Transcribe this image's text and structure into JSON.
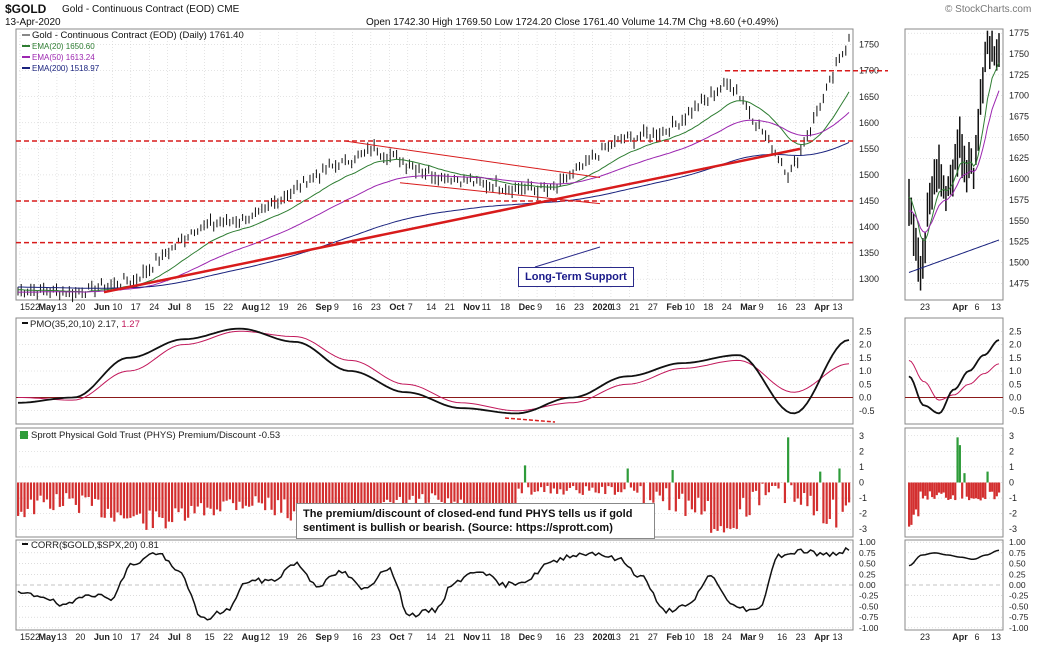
{
  "header": {
    "symbol": "$GOLD",
    "symbol_desc": "Gold - Continuous Contract (EOD) CME",
    "date": "13-Apr-2020",
    "ohlc": "Open 1742.30  High 1769.50  Low 1724.20  Close 1761.40  Volume 14.7M  Chg +8.60 (+0.49%)",
    "watermark": "© StockCharts.com"
  },
  "colors": {
    "ema20": "#2e7d32",
    "ema50": "#9c27b0",
    "ema200": "#1a237e",
    "support": "#d81b1b",
    "pmo": "#111111",
    "pmo_signal": "#c2185b",
    "positive_bar": "#2e9c3a",
    "negative_bar": "#d32f2f",
    "grid": "#c8c8c8"
  },
  "callouts": {
    "support_label": "Long-Term Support",
    "phys_note": "The premium/discount of closed-end fund PHYS tells us if gold sentiment is bullish or bearish. (Source: https://sprott.com)"
  },
  "chart_data": [
    {
      "type": "line",
      "panel": "price-daily",
      "legend": [
        "Gold - Continuous Contract (EOD) (Daily) 1761.40",
        "EMA(20) 1650.60",
        "EMA(50) 1613.24",
        "EMA(200) 1518.97"
      ],
      "y_ticks": [
        1300,
        1350,
        1400,
        1450,
        1500,
        1550,
        1600,
        1650,
        1700,
        1750
      ],
      "ylim": [
        1260,
        1780
      ],
      "x_tick_labels": [
        "1522",
        "May",
        "13",
        "20",
        "Jun",
        "10",
        "17",
        "24",
        "Jul",
        "8",
        "15",
        "22",
        "Aug",
        "12",
        "19",
        "26",
        "Sep",
        "9",
        "16",
        "23",
        "Oct",
        "7",
        "14",
        "21",
        "Nov",
        "11",
        "18",
        "Dec",
        "9",
        "16",
        "23",
        "2020",
        "13",
        "21",
        "27",
        "Feb",
        "10",
        "18",
        "24",
        "Mar",
        "9",
        "16",
        "23",
        "Apr",
        "13"
      ],
      "horizontal_levels": [
        1700,
        1565,
        1450,
        1370
      ],
      "anchor_points": [
        {
          "date": "Apr-2019",
          "close": 1280
        },
        {
          "date": "May-2019",
          "close": 1275
        },
        {
          "date": "Jun-2019",
          "close": 1300
        },
        {
          "date": "Jun-2019",
          "close": 1400
        },
        {
          "date": "Jul-2019",
          "close": 1420
        },
        {
          "date": "Aug-2019",
          "close": 1500
        },
        {
          "date": "Sep-2019",
          "close": 1550
        },
        {
          "date": "Oct-2019",
          "close": 1500
        },
        {
          "date": "Nov-2019",
          "close": 1480
        },
        {
          "date": "Dec-2019",
          "close": 1470
        },
        {
          "date": "Jan-2020",
          "close": 1560
        },
        {
          "date": "Feb-2020",
          "close": 1590
        },
        {
          "date": "Feb-2020",
          "close": 1680
        },
        {
          "date": "Mar-2020",
          "close": 1500
        },
        {
          "date": "Apr-2020",
          "close": 1761
        }
      ]
    },
    {
      "type": "line",
      "panel": "price-zoom",
      "y_ticks": [
        1475,
        1500,
        1525,
        1550,
        1575,
        1600,
        1625,
        1650,
        1675,
        1700,
        1725,
        1750,
        1775
      ],
      "ylim": [
        1455,
        1780
      ],
      "x_tick_labels": [
        "23",
        "Apr",
        "6",
        "13"
      ]
    },
    {
      "type": "line",
      "panel": "pmo",
      "legend": [
        "PMO(35,20,10) 2.17,",
        "1.27"
      ],
      "series": [
        {
          "name": "PMO",
          "values": [
            -0.2,
            0.0,
            1.5,
            2.2,
            2.6,
            2.1,
            1.0,
            0.2,
            -0.4,
            -0.6,
            0.0,
            0.8,
            1.3,
            1.6,
            -0.6,
            2.17
          ]
        },
        {
          "name": "Signal",
          "values": [
            0.0,
            -0.1,
            1.0,
            2.0,
            2.5,
            2.3,
            1.4,
            0.5,
            -0.2,
            -0.5,
            -0.2,
            0.5,
            1.1,
            1.4,
            0.2,
            1.27
          ]
        }
      ],
      "y_ticks": [
        -0.5,
        0.0,
        0.5,
        1.0,
        1.5,
        2.0,
        2.5
      ],
      "ylim": [
        -1.0,
        3.0
      ]
    },
    {
      "type": "bar",
      "panel": "phys-premium",
      "legend": "Sprott Physical Gold Trust (PHYS) Premium/Discount -0.53",
      "y_ticks": [
        -3,
        -2,
        -1,
        0,
        1,
        2,
        3
      ],
      "ylim": [
        -3.5,
        3.5
      ]
    },
    {
      "type": "line",
      "panel": "correlation",
      "legend": "CORR($GOLD,$SPX,20) 0.81",
      "y_ticks": [
        -1.0,
        -0.75,
        -0.5,
        -0.25,
        0.0,
        0.25,
        0.5,
        0.75,
        1.0
      ],
      "ylim": [
        -1.05,
        1.05
      ]
    }
  ]
}
